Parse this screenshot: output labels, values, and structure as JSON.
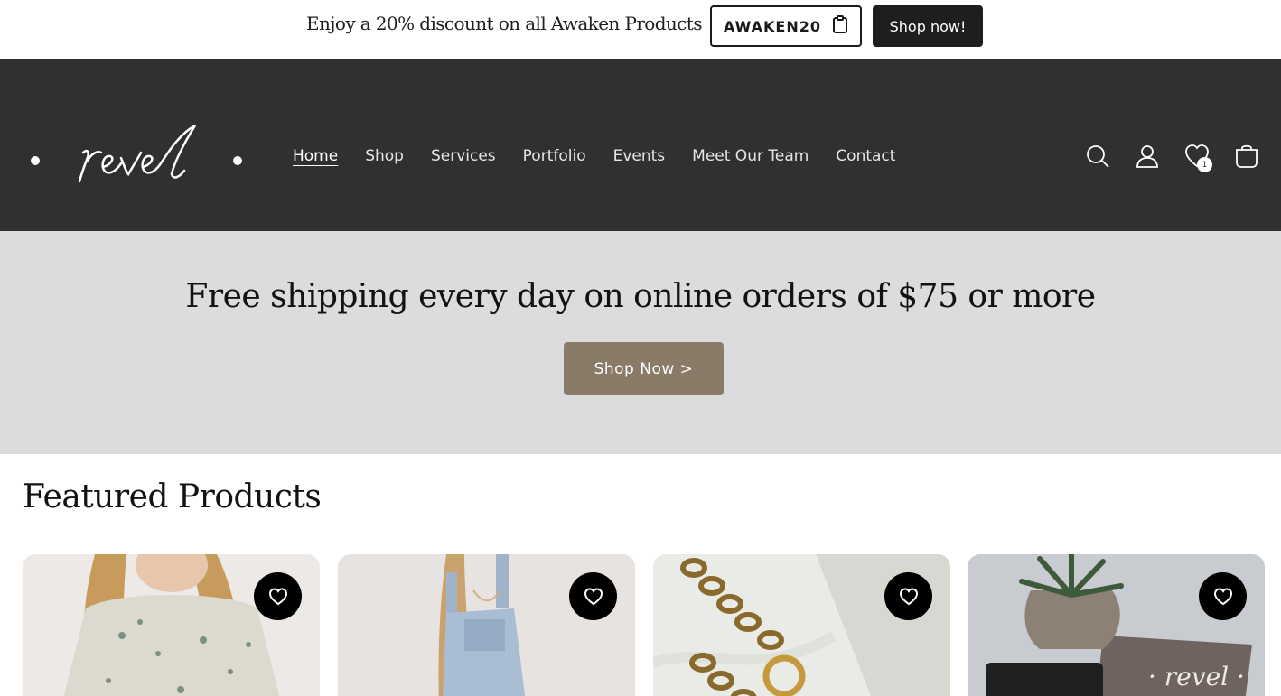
{
  "announcement": {
    "text": "Enjoy a 20% discount on all Awaken Products",
    "code": "AWAKEN20",
    "shop_label": "Shop now!"
  },
  "header": {
    "logo_text": "revel",
    "nav": [
      "Home",
      "Shop",
      "Services",
      "Portfolio",
      "Events",
      "Meet Our Team",
      "Contact"
    ],
    "active_nav": "Home",
    "wishlist_count": "1",
    "icons": [
      "search-icon",
      "account-icon",
      "wishlist-icon",
      "cart-icon"
    ]
  },
  "promo": {
    "title": "Free shipping every day on online orders of $75 or more",
    "button_label": "Shop Now >"
  },
  "featured": {
    "title": "Featured Products",
    "products": [
      {
        "image": "floral-sweatshirt"
      },
      {
        "image": "denim-overalls"
      },
      {
        "image": "gold-chain-necklace"
      },
      {
        "image": "revel-gift-card-succulent"
      }
    ]
  },
  "colors": {
    "header_bg": "#303030",
    "promo_bg": "#dcdcdc",
    "promo_button": "#8a7b68",
    "dark_button": "#1e1e1e"
  }
}
